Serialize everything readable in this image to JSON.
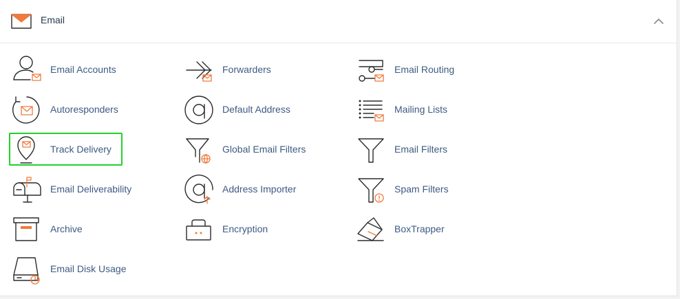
{
  "section": {
    "title": "Email",
    "icon": "envelope-icon",
    "collapse_icon": "chevron-up-icon"
  },
  "items": [
    {
      "label": "Email Accounts",
      "icon": "user-envelope-icon"
    },
    {
      "label": "Forwarders",
      "icon": "forward-arrow-icon"
    },
    {
      "label": "Email Routing",
      "icon": "routing-icon"
    },
    {
      "label": "Autoresponders",
      "icon": "autoresponder-icon"
    },
    {
      "label": "Default Address",
      "icon": "at-sign-icon"
    },
    {
      "label": "Mailing Lists",
      "icon": "list-icon"
    },
    {
      "label": "Track Delivery",
      "icon": "map-pin-envelope-icon"
    },
    {
      "label": "Global Email Filters",
      "icon": "globe-filter-icon"
    },
    {
      "label": "Email Filters",
      "icon": "filter-icon"
    },
    {
      "label": "Email Deliverability",
      "icon": "mailbox-icon"
    },
    {
      "label": "Address Importer",
      "icon": "at-import-icon"
    },
    {
      "label": "Spam Filters",
      "icon": "spam-filter-icon"
    },
    {
      "label": "Archive",
      "icon": "archive-box-icon"
    },
    {
      "label": "Encryption",
      "icon": "lock-icon"
    },
    {
      "label": "BoxTrapper",
      "icon": "boxtrapper-icon"
    },
    {
      "label": "Email Disk Usage",
      "icon": "disk-usage-icon"
    }
  ],
  "colors": {
    "accent": "#f07a3c",
    "link": "#3e5a82",
    "highlight": "#22d02a"
  }
}
